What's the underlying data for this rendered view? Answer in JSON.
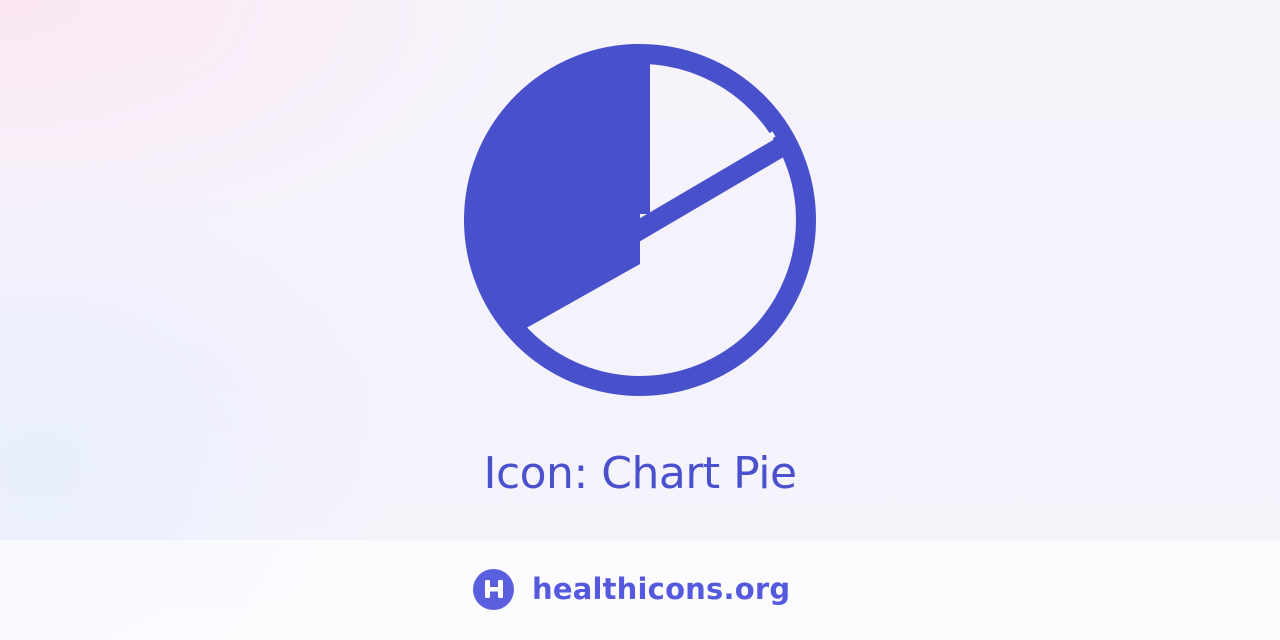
{
  "page": {
    "title": "Icon: Chart Pie"
  },
  "icon": {
    "name": "chart-pie-icon",
    "color": "#4850cc"
  },
  "brand": {
    "name": "healthicons.org",
    "logo_letter": "H",
    "color": "#5a5fe0"
  },
  "colors": {
    "accent": "#4850cc",
    "background": "#f5f3fb",
    "footer": "#fbfbfd"
  }
}
